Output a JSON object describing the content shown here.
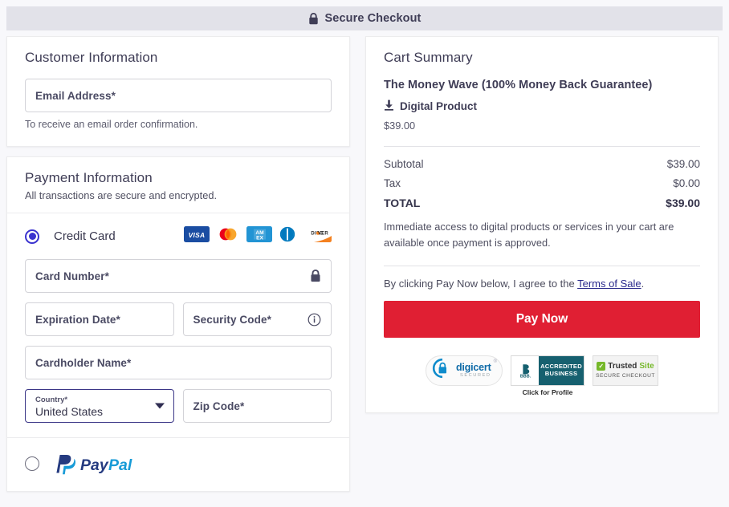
{
  "header": {
    "title": "Secure Checkout",
    "lock_icon": "lock-icon"
  },
  "customer": {
    "section_title": "Customer Information",
    "email_placeholder": "Email Address*",
    "email_value": "",
    "helper_text": "To receive an email order confirmation."
  },
  "payment": {
    "section_title": "Payment Information",
    "subtitle": "All transactions are secure and encrypted.",
    "methods": [
      {
        "id": "credit-card",
        "label": "Credit Card",
        "selected": true
      },
      {
        "id": "paypal",
        "label": "PayPal",
        "selected": false
      }
    ],
    "accepted_cards": [
      "visa",
      "mastercard",
      "amex",
      "diners",
      "discover"
    ],
    "fields": {
      "card_number_placeholder": "Card Number*",
      "card_number_value": "",
      "card_number_icon": "lock-icon",
      "expiration_placeholder": "Expiration Date*",
      "expiration_value": "",
      "security_code_placeholder": "Security Code*",
      "security_code_value": "",
      "security_code_icon": "info-icon",
      "cardholder_placeholder": "Cardholder Name*",
      "cardholder_value": "",
      "country_label": "Country*",
      "country_value": "United States",
      "zip_placeholder": "Zip Code*",
      "zip_value": ""
    },
    "paypal_logo_text": "PayPal"
  },
  "cart": {
    "section_title": "Cart Summary",
    "product_name": "The Money Wave (100% Money Back Guarantee)",
    "product_type": "Digital Product",
    "product_type_icon": "download-icon",
    "product_price": "$39.00",
    "lines": [
      {
        "label": "Subtotal",
        "value": "$39.00"
      },
      {
        "label": "Tax",
        "value": "$0.00"
      }
    ],
    "total_label": "TOTAL",
    "total_value": "$39.00",
    "access_note": "Immediate access to digital products or services in your cart are available once payment is approved.",
    "terms_prefix": "By clicking Pay Now below, I agree to the ",
    "terms_link": "Terms of Sale",
    "terms_suffix": ".",
    "pay_button": "Pay Now",
    "pay_button_color": "#e01f33"
  },
  "badges": {
    "digicert_name": "digicert",
    "digicert_sub": "SECURED",
    "digicert_mark": "®",
    "bbb_abbrev": "BBB.",
    "bbb_line1": "ACCREDITED",
    "bbb_line2": "BUSINESS",
    "bbb_caption": "Click for Profile",
    "trusted_name": "Trusted",
    "trusted_name2": "Site",
    "trusted_sub": "SECURE CHECKOUT",
    "trusted_check": "✓"
  },
  "theme": {
    "accent_radio": "#3a32cf",
    "focus_border": "#3b3687",
    "text_dark": "#3f3d56",
    "bar_bg": "#e2e2e9"
  }
}
